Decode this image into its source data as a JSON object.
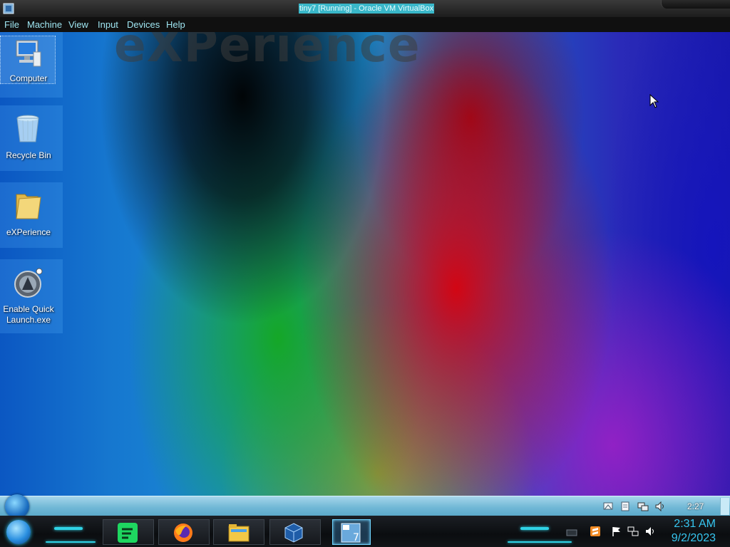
{
  "host": {
    "title": "tiny7 [Running] - Oracle VM VirtualBox",
    "menu": [
      "File",
      "Machine",
      "View",
      "Input",
      "Devices",
      "Help"
    ]
  },
  "desktop": {
    "wallpaper_text": "eXPerience",
    "icons": [
      {
        "label": "Computer",
        "icon": "computer-icon",
        "selected": true
      },
      {
        "label": "Recycle Bin",
        "icon": "recycle-bin-icon",
        "selected": false
      },
      {
        "label": "eXPerience",
        "icon": "folder-icon",
        "selected": false
      },
      {
        "label": "Enable Quick Launch.exe",
        "icon": "quick-launch-icon",
        "selected": false
      }
    ]
  },
  "vm_taskbar": {
    "clock": "2:27",
    "tray_icons": [
      "network-share-icon",
      "document-icon",
      "network-icon",
      "volume-icon"
    ]
  },
  "host_taskbar": {
    "apps": [
      "spotify-icon",
      "firefox-icon",
      "file-explorer-icon",
      "virtualbox-icon",
      "tiny7-vm-icon"
    ],
    "active_app": "tiny7-vm-icon",
    "tray_icons": [
      "keyboard-icon",
      "sublime-icon",
      "flag-icon",
      "network-icon",
      "volume-icon"
    ],
    "time": "2:31 AM",
    "date": "9/2/2023"
  },
  "colors": {
    "accent": "#2fd3e6",
    "title_highlight": "#39b7c9",
    "clock_text": "#36c6f0"
  }
}
